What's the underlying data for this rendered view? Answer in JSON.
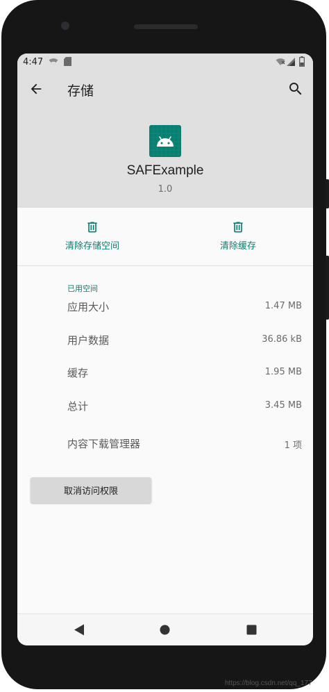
{
  "status_bar": {
    "time": "4:47",
    "icons": [
      "wifi-icon",
      "sd-card-icon",
      "wifi-signal-icon",
      "cell-signal-icon",
      "battery-icon"
    ]
  },
  "app_bar": {
    "title": "存储",
    "back_icon": "arrow-back-icon",
    "search_icon": "search-icon"
  },
  "app_header": {
    "name": "SAFExample",
    "version": "1.0",
    "icon": "android-icon",
    "icon_color": "#087f70"
  },
  "actions": [
    {
      "label": "清除存储空间",
      "icon": "delete-icon"
    },
    {
      "label": "清除缓存",
      "icon": "delete-icon"
    }
  ],
  "storage": {
    "section_title": "已用空间",
    "rows": [
      {
        "label": "应用大小",
        "value": "1.47 MB"
      },
      {
        "label": "用户数据",
        "value": "36.86 kB"
      },
      {
        "label": "缓存",
        "value": "1.95 MB"
      },
      {
        "label": "总计",
        "value": "3.45 MB"
      },
      {
        "label": "内容下载管理器",
        "value": "1 项"
      }
    ]
  },
  "revoke_button": {
    "label": "取消访问权限"
  },
  "nav_bar": {
    "icons": [
      "back-triangle-icon",
      "home-circle-icon",
      "recents-square-icon"
    ]
  },
  "watermark": "https://blog.csdn.net/qq_177",
  "colors": {
    "accent": "#087f70",
    "header_bg": "#e0e0e0",
    "background": "#fafafa"
  }
}
